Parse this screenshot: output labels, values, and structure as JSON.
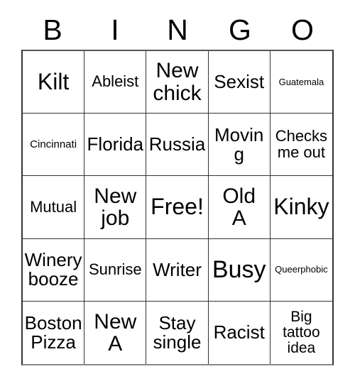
{
  "card": {
    "header_letters": [
      "B",
      "I",
      "N",
      "G",
      "O"
    ],
    "rows": [
      [
        {
          "text": "Kilt",
          "size": "fs-xl"
        },
        {
          "text": "Ableist",
          "size": "fs-s"
        },
        {
          "text": "New\nchick",
          "size": "fs-l"
        },
        {
          "text": "Sexist",
          "size": "fs-m"
        },
        {
          "text": "Guatemala",
          "size": "fs-micro"
        }
      ],
      [
        {
          "text": "Cincinnati",
          "size": "fs-tiny"
        },
        {
          "text": "Florida",
          "size": "fs-m"
        },
        {
          "text": "Russia",
          "size": "fs-m"
        },
        {
          "text": "Moving",
          "size": "fs-m"
        },
        {
          "text": "Checks\nme out",
          "size": "fs-s"
        }
      ],
      [
        {
          "text": "Mutual",
          "size": "fs-s"
        },
        {
          "text": "New\njob",
          "size": "fs-l"
        },
        {
          "text": "Free!",
          "size": "fs-xl"
        },
        {
          "text": "Old\nA",
          "size": "fs-l"
        },
        {
          "text": "Kinky",
          "size": "fs-xl"
        }
      ],
      [
        {
          "text": "Winery\nbooze",
          "size": "fs-m"
        },
        {
          "text": "Sunrise",
          "size": "fs-s"
        },
        {
          "text": "Writer",
          "size": "fs-m"
        },
        {
          "text": "Busy",
          "size": "fs-xxl"
        },
        {
          "text": "Queerphobic",
          "size": "fs-micro"
        }
      ],
      [
        {
          "text": "Boston\nPizza",
          "size": "fs-m"
        },
        {
          "text": "New\nA",
          "size": "fs-l"
        },
        {
          "text": "Stay\nsingle",
          "size": "fs-m"
        },
        {
          "text": "Racist",
          "size": "fs-m"
        },
        {
          "text": "Big\ntattoo\nidea",
          "size": "fs-xs"
        }
      ]
    ],
    "free_space_label": "Free!",
    "colors": {
      "background": "#ffffff",
      "text": "#000000",
      "grid_line": "#333333"
    }
  }
}
